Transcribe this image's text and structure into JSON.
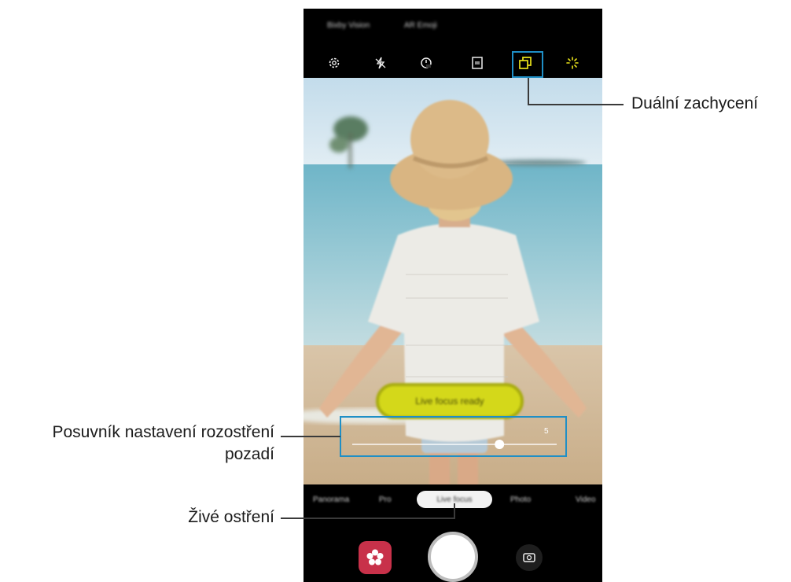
{
  "top_tabs": [
    "Bixby Vision",
    "AR Emoji"
  ],
  "camera_icons": [
    "settings-icon",
    "flash-off-icon",
    "timer-icon",
    "aspect-ratio-icon",
    "dual-capture-icon",
    "effects-icon"
  ],
  "focus_status": "Live focus ready",
  "blur_slider": {
    "value_label": "5",
    "level": 0.72
  },
  "modes": {
    "items": [
      "Panorama",
      "Pro",
      "Live focus",
      "Photo",
      "Video"
    ],
    "selected": "Live focus"
  },
  "bottom_icons": [
    "bixby-flower-icon",
    "shutter-button",
    "switch-camera-icon"
  ],
  "callouts": {
    "dual_capture": "Duální zachycení",
    "blur_slider_line1": "Posuvník nastavení rozostření",
    "blur_slider_line2": "pozadí",
    "live_focus": "Živé ostření"
  },
  "colors": {
    "callout_frame": "#1f8fc6",
    "focus_pill": "#d4d81a",
    "gallery_icon_bg": "#c8314a"
  }
}
